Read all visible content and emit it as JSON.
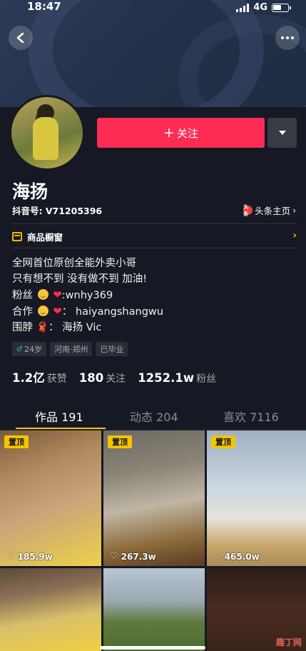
{
  "status_bar": {
    "time": "18:47",
    "network": "4G"
  },
  "header": {
    "back_icon": "back-arrow-icon",
    "more_icon": "more-dots-icon"
  },
  "profile": {
    "follow_label": "关注",
    "nickname": "海扬",
    "douyin_id": "抖音号: V71205396",
    "toutiao_link": "头条主页",
    "toutiao_icon_text": "头条",
    "shop_label": "商品橱窗"
  },
  "bio": {
    "line1": "全网首位原创全能外卖小哥",
    "line2": "只有想不到 没有做不到 加油!",
    "line3_prefix": "粉丝",
    "line3_suffix": ":wnhy369",
    "line4_prefix": "合作",
    "line4_suffix": "： haiyangshangwu",
    "line5_prefix": "围脖",
    "line5_suffix": "： 海扬 Vic"
  },
  "tags": [
    "24岁",
    "河南·郑州",
    "已毕业"
  ],
  "stats": [
    {
      "value": "1.2亿",
      "label": "获赞"
    },
    {
      "value": "180",
      "label": "关注"
    },
    {
      "value": "1252.1w",
      "label": "粉丝"
    }
  ],
  "tabs": [
    {
      "label": "作品 191",
      "active": true
    },
    {
      "label": "动态 204",
      "active": false
    },
    {
      "label": "喜欢 7116",
      "active": false
    }
  ],
  "videos": [
    {
      "pinned": "置顶",
      "likes": "185.9w"
    },
    {
      "pinned": "置顶",
      "likes": "267.3w"
    },
    {
      "pinned": "置顶",
      "likes": "465.0w"
    },
    {
      "pinned": "",
      "likes": ""
    },
    {
      "pinned": "",
      "likes": ""
    },
    {
      "pinned": "",
      "likes": ""
    }
  ],
  "watermark": "趣丁网",
  "colors": {
    "accent_red": "#fe2c55",
    "accent_yellow": "#f5c400",
    "background": "#161823"
  }
}
